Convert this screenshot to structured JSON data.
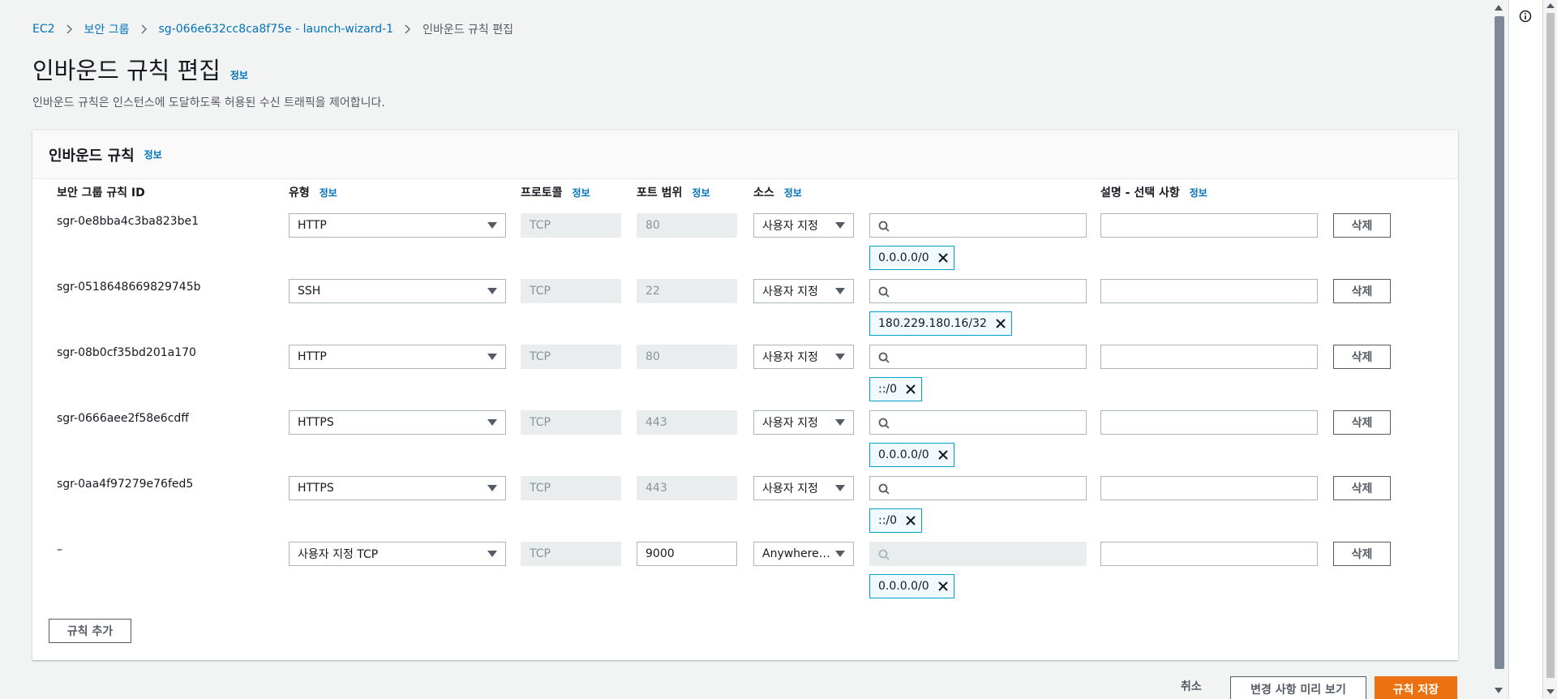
{
  "breadcrumb": {
    "items": [
      "EC2",
      "보안 그룹",
      "sg-066e632cc8ca8f75e - launch-wizard-1"
    ],
    "current": "인바운드 규칙 편집"
  },
  "page": {
    "title": "인바운드 규칙 편집",
    "info": "정보",
    "description": "인바운드 규칙은 인스턴스에 도달하도록 허용된 수신 트래픽을 제어합니다."
  },
  "panel": {
    "title": "인바운드 규칙",
    "info": "정보"
  },
  "columns": {
    "rule_id": "보안 그룹 규칙 ID",
    "type": "유형",
    "protocol": "프로토콜",
    "port_range": "포트 범위",
    "source": "소스",
    "description": "설명 - 선택 사항",
    "info": "정보"
  },
  "rows": [
    {
      "id": "sgr-0e8bba4c3ba823be1",
      "type": "HTTP",
      "protocol": "TCP",
      "port": "80",
      "source": "사용자 지정",
      "cidr": "0.0.0.0/0",
      "delete": "삭제"
    },
    {
      "id": "sgr-0518648669829745b",
      "type": "SSH",
      "protocol": "TCP",
      "port": "22",
      "source": "사용자 지정",
      "cidr": "180.229.180.16/32",
      "delete": "삭제"
    },
    {
      "id": "sgr-08b0cf35bd201a170",
      "type": "HTTP",
      "protocol": "TCP",
      "port": "80",
      "source": "사용자 지정",
      "cidr": "::/0",
      "delete": "삭제"
    },
    {
      "id": "sgr-0666aee2f58e6cdff",
      "type": "HTTPS",
      "protocol": "TCP",
      "port": "443",
      "source": "사용자 지정",
      "cidr": "0.0.0.0/0",
      "delete": "삭제"
    },
    {
      "id": "sgr-0aa4f97279e76fed5",
      "type": "HTTPS",
      "protocol": "TCP",
      "port": "443",
      "source": "사용자 지정",
      "cidr": "::/0",
      "delete": "삭제"
    },
    {
      "id": "–",
      "type": "사용자 지정 TCP",
      "protocol": "TCP",
      "port": "9000",
      "source": "Anywhere-...",
      "cidr": "0.0.0.0/0",
      "delete": "삭제"
    }
  ],
  "actions": {
    "add_rule": "규칙 추가",
    "cancel": "취소",
    "preview": "변경 사항 미리 보기",
    "save": "규칙 저장"
  },
  "colors": {
    "link": "#0073bb",
    "primary": "#ec7211",
    "token_border": "#00a1c9"
  }
}
